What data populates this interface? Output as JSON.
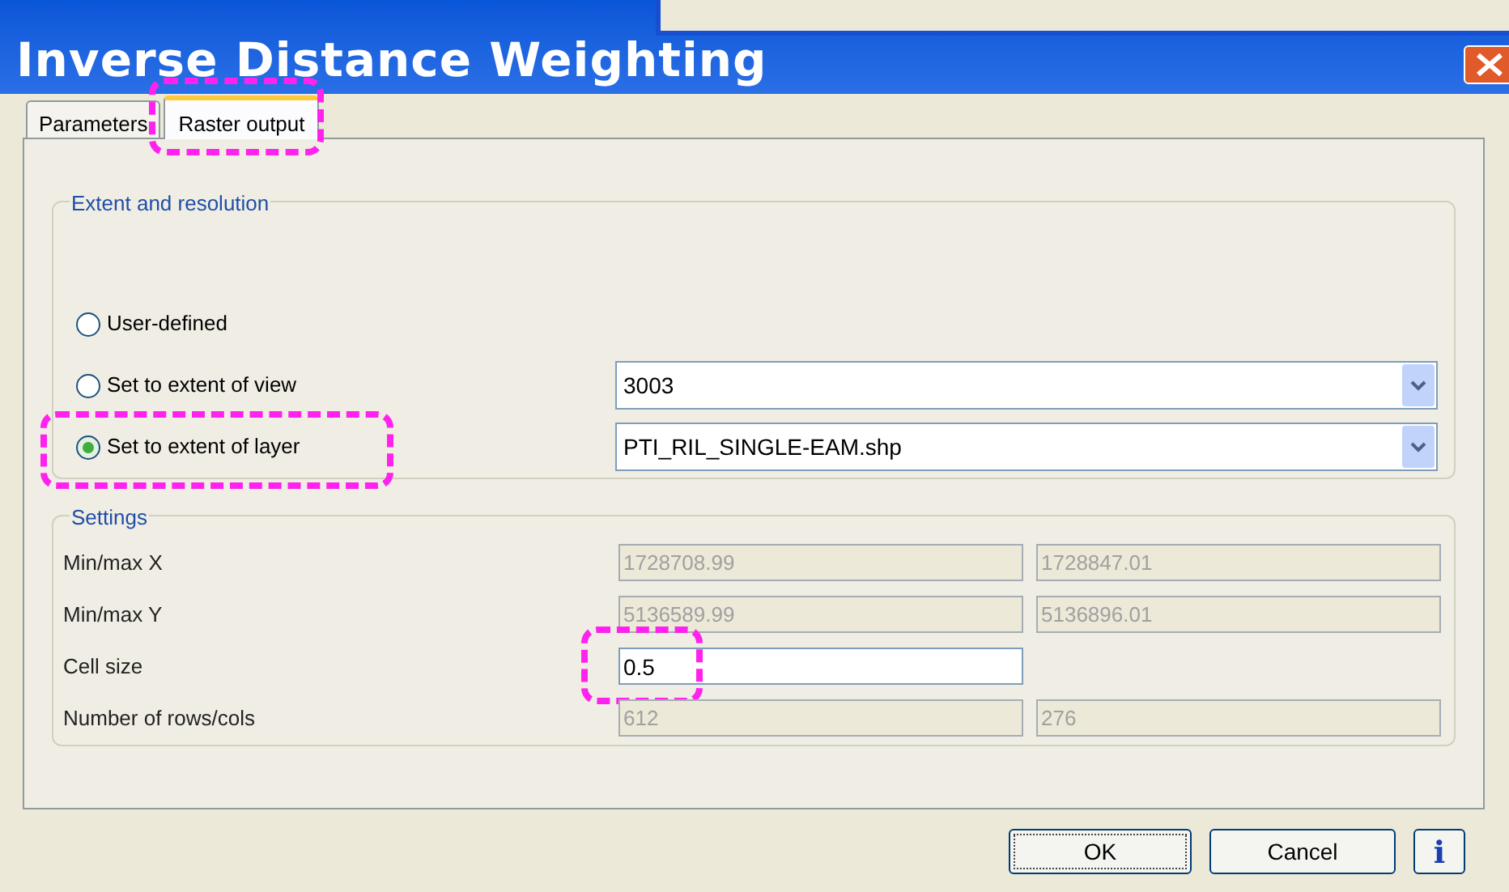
{
  "window": {
    "title": "Inverse Distance Weighting"
  },
  "tabs": [
    {
      "label": "Parameters",
      "selected": false,
      "highlighted": false
    },
    {
      "label": "Raster output",
      "selected": true,
      "highlighted": true
    }
  ],
  "extent_group": {
    "title": "Extent and resolution",
    "options": [
      {
        "label": "User-defined",
        "selected": false,
        "highlighted": false
      },
      {
        "label": "Set to extent of view",
        "selected": false,
        "highlighted": false,
        "dropdown": "3003"
      },
      {
        "label": "Set to extent of layer",
        "selected": true,
        "highlighted": true,
        "dropdown": "PTI_RIL_SINGLE-EAM.shp"
      }
    ]
  },
  "settings_group": {
    "title": "Settings",
    "rows": [
      {
        "label": "Min/max X",
        "fields": [
          {
            "value": "1728708.99",
            "disabled": true,
            "highlighted": false
          },
          {
            "value": "1728847.01",
            "disabled": true,
            "highlighted": false
          }
        ]
      },
      {
        "label": "Min/max Y",
        "fields": [
          {
            "value": "5136589.99",
            "disabled": true,
            "highlighted": false
          },
          {
            "value": "5136896.01",
            "disabled": true,
            "highlighted": false
          }
        ]
      },
      {
        "label": "Cell size",
        "fields": [
          {
            "value": "0.5",
            "disabled": false,
            "highlighted": true
          }
        ]
      },
      {
        "label": "Number of rows/cols",
        "fields": [
          {
            "value": "612",
            "disabled": true,
            "highlighted": false
          },
          {
            "value": "276",
            "disabled": true,
            "highlighted": false
          }
        ]
      }
    ]
  },
  "buttons": [
    {
      "label": "OK",
      "default": true
    },
    {
      "label": "Cancel",
      "default": false
    }
  ],
  "info_button": {
    "label": "i"
  }
}
